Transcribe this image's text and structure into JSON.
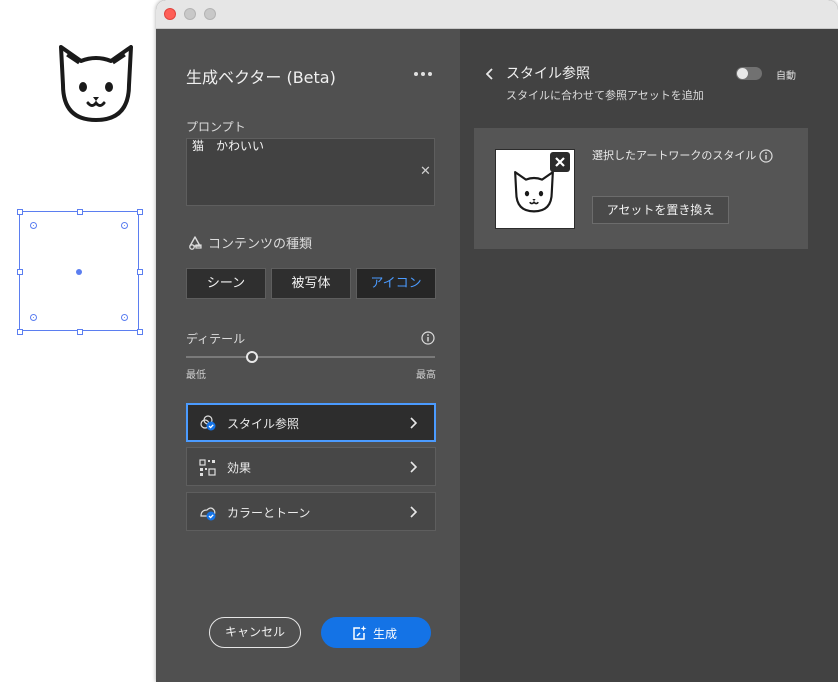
{
  "canvas": {
    "artwork_icon": "cat-face-icon"
  },
  "panel": {
    "title": "生成ベクター (Beta)",
    "more_icon": "more-horizontal-icon",
    "prompt_label": "プロンプト",
    "prompt_value": "猫　かわいい",
    "prompt_clear_icon": "close-icon",
    "content_type_label": "コンテンツの種類",
    "content_type_options": [
      "シーン",
      "被写体",
      "アイコン"
    ],
    "content_type_selected": "アイコン",
    "detail_label": "ディテール",
    "detail_min": "最低",
    "detail_max": "最高",
    "detail_level": 0.26,
    "rows": [
      {
        "label": "スタイル参照",
        "icon": "style-reference-icon",
        "selected": true
      },
      {
        "label": "効果",
        "icon": "effects-grid-icon",
        "selected": false
      },
      {
        "label": "カラーとトーン",
        "icon": "color-tone-icon",
        "selected": false
      }
    ],
    "cancel_label": "キャンセル",
    "generate_label": "生成"
  },
  "style_panel": {
    "title": "スタイル参照",
    "subtitle": "スタイルに合わせて参照アセットを追加",
    "auto_label": "自動",
    "auto_enabled": false,
    "reference_description": "選択したアートワークのスタイル",
    "replace_label": "アセットを置き換え"
  },
  "colors": {
    "accent": "#1473e6",
    "selected_text": "#4b9bff",
    "selection": "#5b7ef0"
  }
}
